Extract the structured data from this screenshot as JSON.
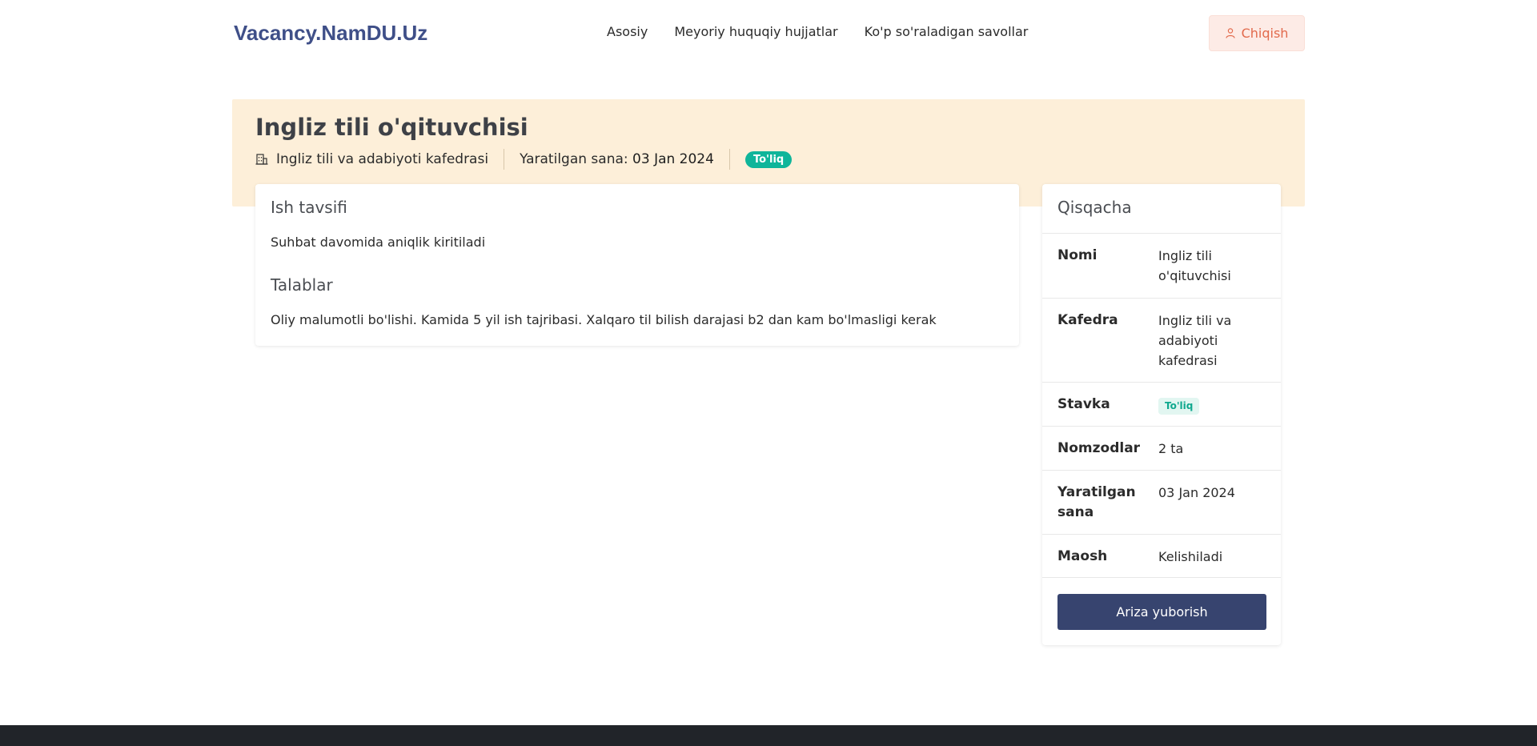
{
  "header": {
    "brand": "Vacancy.NamDU.Uz",
    "nav": [
      "Asosiy",
      "Meyoriy huquqiy hujjatlar",
      "Ko'p so'raladigan savollar"
    ],
    "logout_label": "Chiqish"
  },
  "hero": {
    "title": "Ingliz tili o'qituvchisi",
    "department": "Ingliz tili va adabiyoti kafedrasi",
    "created_label": "Yaratilgan sana:",
    "created_value": "03 Jan 2024",
    "rate_badge": "To'liq"
  },
  "description": {
    "heading": "Ish tavsifi",
    "text": "Suhbat davomida aniqlik kiritiladi",
    "req_heading": "Talablar",
    "req_text": "Oliy malumotli bo'lishi. Kamida 5 yil ish tajribasi. Xalqaro til bilish darajasi b2 dan kam bo'lmasligi kerak"
  },
  "summary": {
    "title": "Qisqacha",
    "rows": [
      {
        "key": "Nomi",
        "value": "Ingliz tili o'qituvchisi"
      },
      {
        "key": "Kafedra",
        "value": "Ingliz tili va adabiyoti kafedrasi"
      },
      {
        "key": "Stavka",
        "value": "To'liq"
      },
      {
        "key": "Nomzodlar",
        "value": "2 ta"
      },
      {
        "key": "Yaratilgan sana",
        "value": "03 Jan 2024"
      },
      {
        "key": "Maosh",
        "value": "Kelishiladi"
      }
    ],
    "apply_label": "Ariza yuborish"
  },
  "colors": {
    "brand": "#3f4f88",
    "hero_bg": "#fdefd9",
    "badge": "#0fb59a",
    "logout": "#e26a4c",
    "primary_button": "#37446f"
  },
  "icons": {
    "department": "building-icon",
    "logout": "user-icon"
  }
}
